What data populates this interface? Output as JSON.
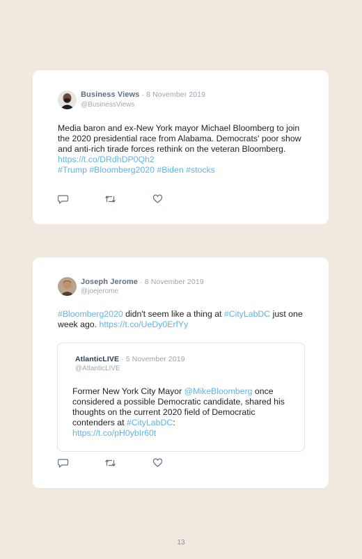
{
  "tweets": [
    {
      "author": "Business Views",
      "date": "· 8 November 2019",
      "handle": "@BusinessViews",
      "body_text": "Media baron and ex-New York mayor Michael Bloomberg to join the 2020 presidential race from Alabama. Democrats' poor show and anti-rich tirade forces rethink on the veteran Bloomberg. ",
      "link": "https://t.co/DRdhDP0Qh2",
      "hashtags": "#Trump #Bloomberg2020 #Biden #stocks"
    },
    {
      "author": "Joseph Jerome",
      "date": "· 8 November 2019",
      "handle": "@joejerome",
      "tag1": "#Bloomberg2020",
      "mid_text": " didn't seem like a thing at ",
      "tag2": "#CityLabDC",
      "end_text": " just one week ago. ",
      "link": "https://t.co/UeDy0ErfYy",
      "quoted": {
        "author": "AtlanticLIVE",
        "date": "· 5 November 2019",
        "handle": "@AtlanticLIVE",
        "text1": "Former New York City Mayor ",
        "mention": "@MikeBloomberg",
        "text2": " once considered a possible Democratic candidate, shared his thoughts on the current 2020 field of Democratic contenders at ",
        "tag": "#CityLabDC",
        "text3": ":",
        "link": "https://t.co/pH0ybIr60t"
      }
    }
  ],
  "icons": [
    "reply-icon",
    "retweet-icon",
    "like-icon"
  ],
  "page_number": "13"
}
